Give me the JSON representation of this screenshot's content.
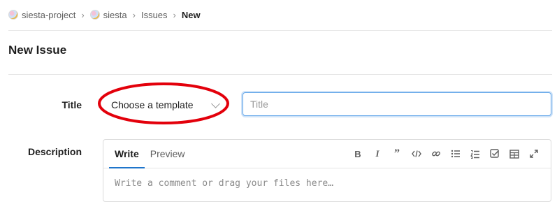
{
  "breadcrumbs": [
    {
      "label": "siesta-project",
      "avatar": true
    },
    {
      "label": "siesta",
      "avatar": true
    },
    {
      "label": "Issues",
      "avatar": false
    },
    {
      "label": "New",
      "avatar": false,
      "current": true
    }
  ],
  "page": {
    "title": "New Issue"
  },
  "form": {
    "title_label": "Title",
    "template_select": {
      "selected": "Choose a template"
    },
    "title_input": {
      "value": "",
      "placeholder": "Title"
    },
    "description_label": "Description",
    "editor": {
      "tabs": [
        "Write",
        "Preview"
      ],
      "active_tab": "Write",
      "toolbar_icons": [
        "bold-icon",
        "italic-icon",
        "quote-icon",
        "code-icon",
        "link-icon",
        "bullet-list-icon",
        "numbered-list-icon",
        "task-list-icon",
        "table-icon",
        "fullscreen-icon"
      ],
      "placeholder": "Write a comment or drag your files here…"
    }
  },
  "colors": {
    "accent": "#1f75cb",
    "annotation": "#e3000b",
    "focus_border": "#63a6e9"
  }
}
